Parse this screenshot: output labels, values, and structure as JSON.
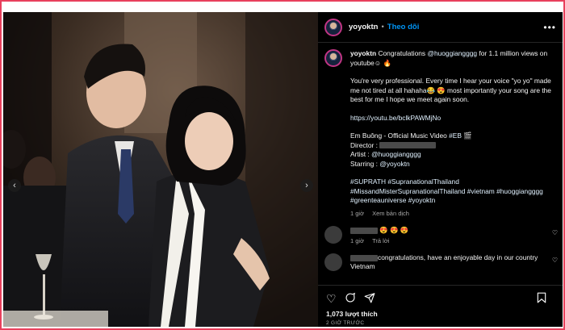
{
  "post": {
    "username": "yoyoktn",
    "follow_label": "Theo dõi",
    "more_label": "•••",
    "caption": {
      "line1_prefix": "Congratulations ",
      "line1_mention": "@huoggiangggg",
      "line1_suffix": " for 1.1 million views on youtube☺ 🔥",
      "para2": "You're very professional. Every time I hear your voice \"yo yo\" made me not tired at all hahaha😂 😍 most importantly your song are the best for me I hope we meet again soon.",
      "link": "https://youtu.be/bclkPAWMjNo",
      "video_prefix": "Em Buông - Official Music Video ",
      "video_tag": "#EB",
      "video_suffix": " 🎬",
      "director_label": "Director : ",
      "artist_label": "Artist : ",
      "artist_mention": "@huoggiangggg",
      "starring_label": "Starring : ",
      "starring_mention": "@yoyoktn",
      "hashtags": "#SUPRATH #SupranationalThailand #MissandMisterSupranationalThailand #vietnam #huoggiangggg #greenteauniverse #yoyoktn"
    },
    "caption_meta": {
      "time": "1 giờ",
      "translate": "Xem bản dịch"
    },
    "comments": [
      {
        "text": "😍 😍 😍",
        "time": "1 giờ",
        "reply": "Trả lời"
      },
      {
        "text": "congratulations, have an enjoyable day in our country Vietnam"
      }
    ],
    "likes": "1,073 lượt thích",
    "timestamp": "2 GIỜ TRƯỚC",
    "icons": [
      "heart-icon",
      "comment-icon",
      "share-icon",
      "bookmark-icon"
    ],
    "carousel": {
      "prev": "‹",
      "next": "›"
    }
  },
  "colors": {
    "accent": "#0095f6",
    "frame": "#e8405c",
    "background": "#000000"
  }
}
